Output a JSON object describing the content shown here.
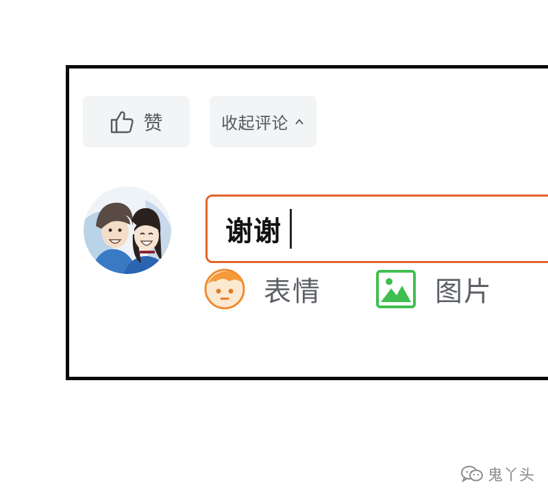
{
  "actions": {
    "like": {
      "icon": "thumbs-up-icon",
      "label": "赞"
    },
    "collapse": {
      "label": "收起评论",
      "icon": "chevron-up-icon"
    }
  },
  "reply": {
    "avatar": "user-avatar",
    "value": "谢谢",
    "border_color": "#e4622a"
  },
  "toolbar": {
    "emoji": {
      "icon": "emoji-face-icon",
      "label": "表情"
    },
    "image": {
      "icon": "picture-icon",
      "label": "图片"
    }
  },
  "watermark": {
    "icon": "wechat-icon",
    "label": "鬼丫头"
  }
}
